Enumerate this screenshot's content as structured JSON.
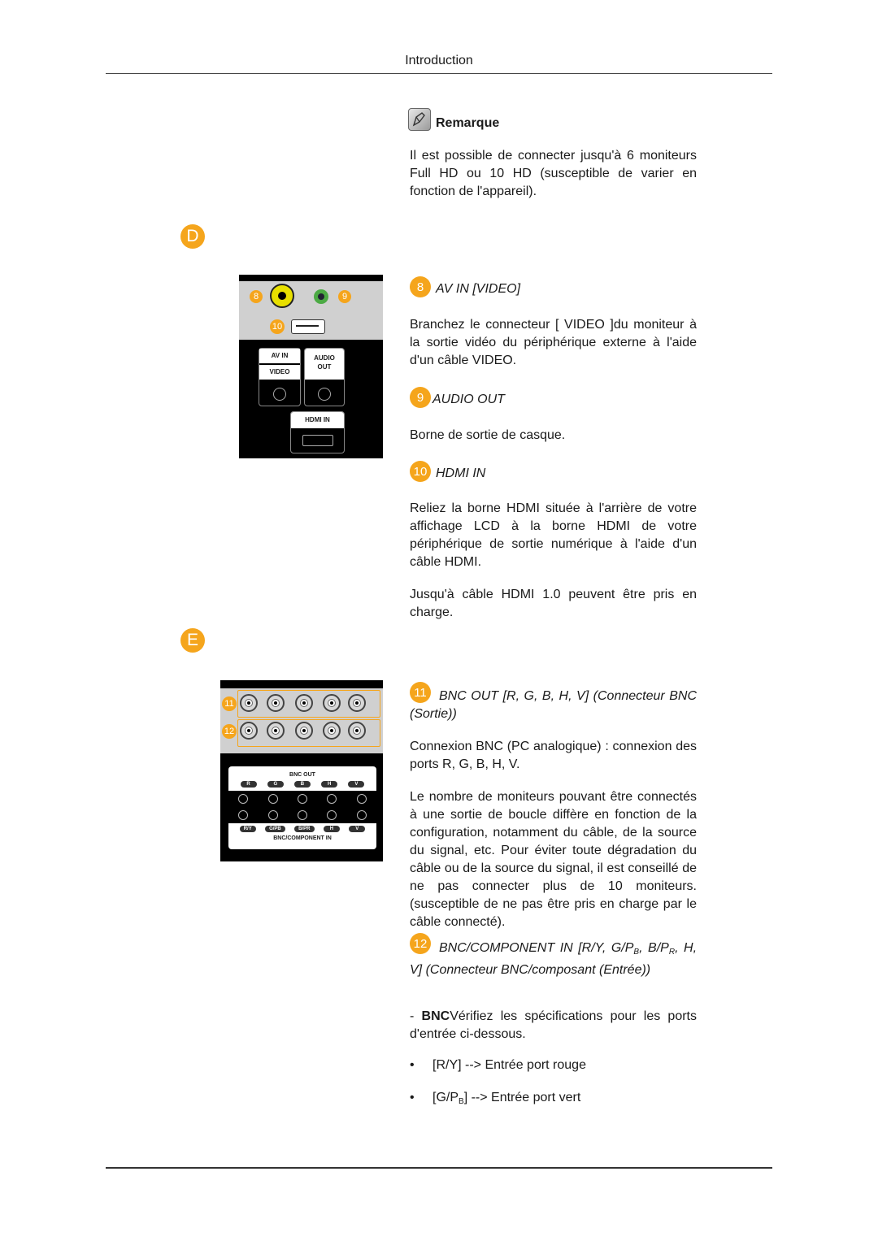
{
  "header": {
    "title": "Introduction"
  },
  "note": {
    "icon": "note-pencil-icon",
    "title": "Remarque",
    "text": "Il est possible de connecter jusqu'à 6 moniteurs Full HD ou 10 HD (susceptible de varier en fonction de l'appareil)."
  },
  "section_d": {
    "letter": "D",
    "panel": {
      "callouts": [
        "8",
        "9",
        "10"
      ],
      "labels": {
        "av_in": "AV IN",
        "video": "VIDEO",
        "audio_out_line1": "AUDIO",
        "audio_out_line2": "OUT",
        "hdmi_in": "HDMI IN"
      }
    },
    "items": [
      {
        "number": "8",
        "title": "AV IN [VIDEO]",
        "paragraphs": [
          "Branchez le connecteur [ VIDEO ]du moniteur à la sortie vidéo du périphérique externe à l'aide d'un câble VIDEO."
        ]
      },
      {
        "number": "9",
        "title": "AUDIO OUT",
        "paragraphs": [
          "Borne de sortie de casque."
        ]
      },
      {
        "number": "10",
        "title": "HDMI IN",
        "paragraphs": [
          "Reliez la borne HDMI située à l'arrière de votre affichage LCD à la borne HDMI de votre périphérique de sortie numérique à l'aide d'un câble HDMI.",
          "Jusqu'à câble HDMI 1.0 peuvent être pris en charge."
        ]
      }
    ]
  },
  "section_e": {
    "letter": "E",
    "panel": {
      "callouts": [
        "11",
        "12"
      ],
      "bnc_out_label": "BNC OUT",
      "bnc_out_ports": [
        "R",
        "G",
        "B",
        "H",
        "V"
      ],
      "bnc_in_ports": [
        "R/Y",
        "G/PB",
        "B/PR",
        "H",
        "V"
      ],
      "bnc_in_label": "BNC/COMPONENT IN"
    },
    "items": [
      {
        "number": "11",
        "title": "BNC OUT [R, G, B, H, V] (Connecteur BNC (Sortie))",
        "paragraphs": [
          "Connexion BNC (PC analogique) : connexion des ports R, G, B, H, V.",
          "Le nombre de moniteurs pouvant être connectés à une sortie de boucle diffère en fonction de la configuration, notamment du câble, de la source du signal, etc. Pour éviter toute dégradation du câble ou de la source du signal, il est conseillé de ne pas connecter plus de 10 moniteurs. (susceptible de ne pas être pris en charge par le câble connecté)."
        ]
      },
      {
        "number": "12",
        "title_parts": {
          "a": "BNC/COMPONENT IN [R/Y, G/P",
          "sub1": "B",
          "b": ", B/P",
          "sub2": "R",
          "c": ", H, V] (Connecteur BNC/composant (Entrée))"
        },
        "intro_prefix": "- ",
        "intro_bold": "BNC",
        "intro_rest": "Vérifiez les spécifications pour les ports d'entrée ci-dessous.",
        "bullets": [
          {
            "pre": "[R/Y] --> Entrée port rouge"
          },
          {
            "pre": "[G/P",
            "sub": "B",
            "post": "] --> Entrée port vert"
          }
        ]
      }
    ]
  }
}
